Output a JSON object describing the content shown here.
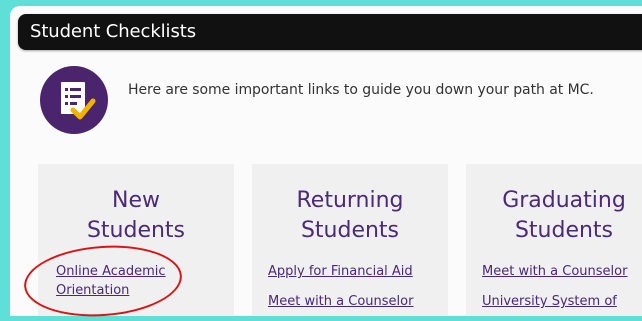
{
  "header": {
    "title": "Student Checklists"
  },
  "intro": {
    "text": "Here are some important links to guide you down your path at MC.",
    "icon": "checklist-icon"
  },
  "cards": [
    {
      "title_line1": "New",
      "title_line2": "Students",
      "links": [
        {
          "line1": "Online Academic",
          "line2": "Orientation"
        }
      ]
    },
    {
      "title_line1": "Returning",
      "title_line2": "Students",
      "links": [
        {
          "label": "Apply for Financial Aid"
        },
        {
          "label": "Meet with a Counselor"
        }
      ]
    },
    {
      "title_line1": "Graduating",
      "title_line2": "Students",
      "links": [
        {
          "label": "Meet with a Counselor"
        },
        {
          "label": "University System of"
        }
      ]
    }
  ],
  "colors": {
    "background": "#5ee0d8",
    "header": "#111111",
    "accent": "#4b2a78",
    "annotation": "#d91414"
  }
}
